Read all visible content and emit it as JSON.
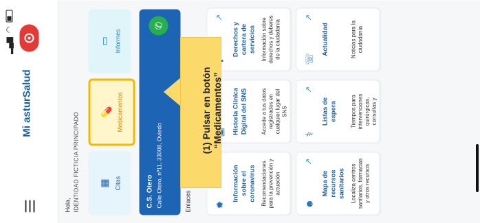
{
  "header": {
    "title": "Mi asturSalud",
    "greeting": "Hola,",
    "identity": "IDENTIDAD FICTICIA PRINCIPADO"
  },
  "quick_actions": [
    {
      "label": "Citas",
      "icon": "calendar-icon"
    },
    {
      "label": "Medicamentos",
      "icon": "pill-icon",
      "highlight_color": "#F5B800"
    },
    {
      "label": "Informes",
      "icon": "document-icon"
    }
  ],
  "center": {
    "name": "C.S. Otero",
    "address": "Calle Otero, nº11, 33008, Oviedo"
  },
  "links_section": {
    "title": "Enlaces"
  },
  "cards": [
    {
      "title": "Información sobre el coronavirus",
      "description": "Recomendaciones para la prevención y actuación",
      "icon": "virus-icon"
    },
    {
      "title": "Mapa de recursos sanitarios",
      "description": "Localiza centros sanitarios, farmacias y otros recursos",
      "icon": "people-icon"
    },
    {
      "title": "Historia Clínica Digital del SNS",
      "description": "Accede a tus datos registrados en cualquier lugar del SNS",
      "icon": "id-card-icon"
    },
    {
      "title": "Listas de espera",
      "description": "Tiempos para intervenciones quirúrgicas, consultas y",
      "icon": "stretcher-icon"
    },
    {
      "title": "Derechos y cartera de servicios",
      "description": "Información sobre derechos y deberes de la ciudadanía",
      "icon": "medical-bag-icon"
    },
    {
      "title": "Actualidad",
      "description": "Noticias para la ciudadanía",
      "icon": "megaphone-icon"
    }
  ],
  "callout": {
    "line1": "(1) Pulsar en botón",
    "line2": "“Medicamentos”",
    "color": "#FBD96A"
  },
  "colors": {
    "accent": "#1A5EA8",
    "record": "#E53935",
    "call": "#27AE4F",
    "center_bg": "#1E64B4"
  }
}
